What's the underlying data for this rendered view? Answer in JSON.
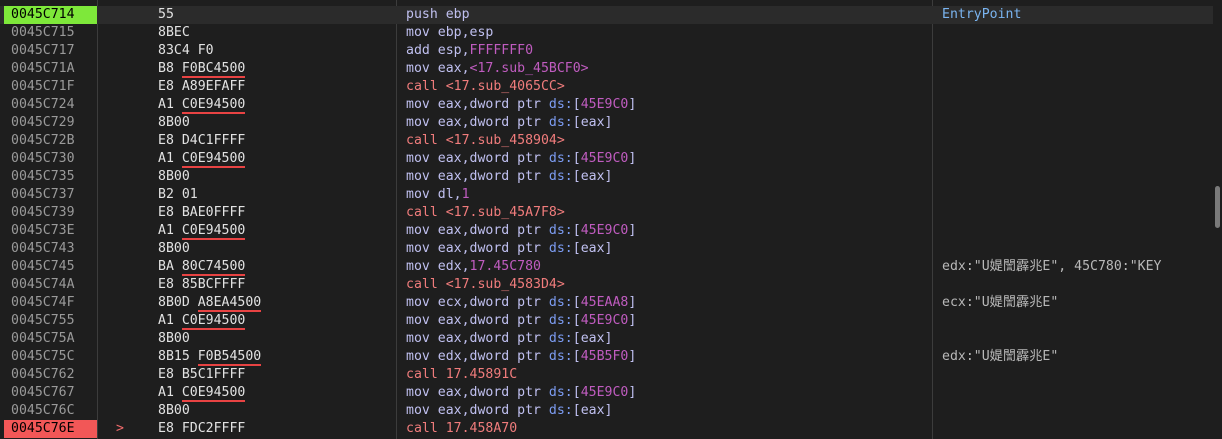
{
  "rows": [
    {
      "addr": "0045C714",
      "state": "eip",
      "mark": "",
      "b1": "55",
      "b2": "",
      "inst": [
        {
          "t": "push ebp",
          "k": "p"
        }
      ],
      "call": false,
      "comment": "EntryPoint",
      "ckind": "ep"
    },
    {
      "addr": "0045C715",
      "state": "",
      "mark": "",
      "b1": "8BEC",
      "b2": "",
      "inst": [
        {
          "t": "mov ebp,esp",
          "k": "p"
        }
      ],
      "call": false,
      "comment": "",
      "ckind": ""
    },
    {
      "addr": "0045C717",
      "state": "",
      "mark": "",
      "b1": "83C4 F0",
      "b2": "",
      "inst": [
        {
          "t": "add esp,",
          "k": "p"
        },
        {
          "t": "FFFFFFF0",
          "k": "n"
        }
      ],
      "call": false,
      "comment": "",
      "ckind": ""
    },
    {
      "addr": "0045C71A",
      "state": "",
      "mark": "",
      "b1": "B8 ",
      "b2": "F0BC4500",
      "inst": [
        {
          "t": "mov eax,",
          "k": "p"
        },
        {
          "t": "<17.sub_45BCF0>",
          "k": "n"
        }
      ],
      "call": false,
      "comment": "",
      "ckind": ""
    },
    {
      "addr": "0045C71F",
      "state": "",
      "mark": "",
      "b1": "E8 A89EFAFF",
      "b2": "",
      "inst": [
        {
          "t": "call <17.sub_4065CC>",
          "k": "p"
        }
      ],
      "call": true,
      "comment": "",
      "ckind": ""
    },
    {
      "addr": "0045C724",
      "state": "",
      "mark": "",
      "b1": "A1 ",
      "b2": "C0E94500",
      "inst": [
        {
          "t": "mov eax,dword ptr ",
          "k": "p"
        },
        {
          "t": "ds:",
          "k": "s"
        },
        {
          "t": "[",
          "k": "p"
        },
        {
          "t": "45E9C0",
          "k": "n"
        },
        {
          "t": "]",
          "k": "p"
        }
      ],
      "call": false,
      "comment": "",
      "ckind": ""
    },
    {
      "addr": "0045C729",
      "state": "",
      "mark": "",
      "b1": "8B00",
      "b2": "",
      "inst": [
        {
          "t": "mov eax,dword ptr ",
          "k": "p"
        },
        {
          "t": "ds:",
          "k": "s"
        },
        {
          "t": "[eax]",
          "k": "p"
        }
      ],
      "call": false,
      "comment": "",
      "ckind": ""
    },
    {
      "addr": "0045C72B",
      "state": "",
      "mark": "",
      "b1": "E8 D4C1FFFF",
      "b2": "",
      "inst": [
        {
          "t": "call <17.sub_458904>",
          "k": "p"
        }
      ],
      "call": true,
      "comment": "",
      "ckind": ""
    },
    {
      "addr": "0045C730",
      "state": "",
      "mark": "",
      "b1": "A1 ",
      "b2": "C0E94500",
      "inst": [
        {
          "t": "mov eax,dword ptr ",
          "k": "p"
        },
        {
          "t": "ds:",
          "k": "s"
        },
        {
          "t": "[",
          "k": "p"
        },
        {
          "t": "45E9C0",
          "k": "n"
        },
        {
          "t": "]",
          "k": "p"
        }
      ],
      "call": false,
      "comment": "",
      "ckind": ""
    },
    {
      "addr": "0045C735",
      "state": "",
      "mark": "",
      "b1": "8B00",
      "b2": "",
      "inst": [
        {
          "t": "mov eax,dword ptr ",
          "k": "p"
        },
        {
          "t": "ds:",
          "k": "s"
        },
        {
          "t": "[eax]",
          "k": "p"
        }
      ],
      "call": false,
      "comment": "",
      "ckind": ""
    },
    {
      "addr": "0045C737",
      "state": "",
      "mark": "",
      "b1": "B2 01",
      "b2": "",
      "inst": [
        {
          "t": "mov dl,",
          "k": "p"
        },
        {
          "t": "1",
          "k": "n"
        }
      ],
      "call": false,
      "comment": "",
      "ckind": ""
    },
    {
      "addr": "0045C739",
      "state": "",
      "mark": "",
      "b1": "E8 BAE0FFFF",
      "b2": "",
      "inst": [
        {
          "t": "call <17.sub_45A7F8>",
          "k": "p"
        }
      ],
      "call": true,
      "comment": "",
      "ckind": ""
    },
    {
      "addr": "0045C73E",
      "state": "",
      "mark": "",
      "b1": "A1 ",
      "b2": "C0E94500",
      "inst": [
        {
          "t": "mov eax,dword ptr ",
          "k": "p"
        },
        {
          "t": "ds:",
          "k": "s"
        },
        {
          "t": "[",
          "k": "p"
        },
        {
          "t": "45E9C0",
          "k": "n"
        },
        {
          "t": "]",
          "k": "p"
        }
      ],
      "call": false,
      "comment": "",
      "ckind": ""
    },
    {
      "addr": "0045C743",
      "state": "",
      "mark": "",
      "b1": "8B00",
      "b2": "",
      "inst": [
        {
          "t": "mov eax,dword ptr ",
          "k": "p"
        },
        {
          "t": "ds:",
          "k": "s"
        },
        {
          "t": "[eax]",
          "k": "p"
        }
      ],
      "call": false,
      "comment": "",
      "ckind": ""
    },
    {
      "addr": "0045C745",
      "state": "",
      "mark": "",
      "b1": "BA ",
      "b2": "80C74500",
      "inst": [
        {
          "t": "mov edx,",
          "k": "p"
        },
        {
          "t": "17.45C780",
          "k": "n"
        }
      ],
      "call": false,
      "comment": "edx:\"U媞誾霹兆E\", 45C780:\"KEY",
      "ckind": "c"
    },
    {
      "addr": "0045C74A",
      "state": "",
      "mark": "",
      "b1": "E8 85BCFFFF",
      "b2": "",
      "inst": [
        {
          "t": "call <17.sub_4583D4>",
          "k": "p"
        }
      ],
      "call": true,
      "comment": "",
      "ckind": ""
    },
    {
      "addr": "0045C74F",
      "state": "",
      "mark": "",
      "b1": "8B0D ",
      "b2": "A8EA4500",
      "inst": [
        {
          "t": "mov ecx,dword ptr ",
          "k": "p"
        },
        {
          "t": "ds:",
          "k": "s"
        },
        {
          "t": "[",
          "k": "p"
        },
        {
          "t": "45EAA8",
          "k": "n"
        },
        {
          "t": "]",
          "k": "p"
        }
      ],
      "call": false,
      "comment": "ecx:\"U媞誾霹兆E\"",
      "ckind": "c"
    },
    {
      "addr": "0045C755",
      "state": "",
      "mark": "",
      "b1": "A1 ",
      "b2": "C0E94500",
      "inst": [
        {
          "t": "mov eax,dword ptr ",
          "k": "p"
        },
        {
          "t": "ds:",
          "k": "s"
        },
        {
          "t": "[",
          "k": "p"
        },
        {
          "t": "45E9C0",
          "k": "n"
        },
        {
          "t": "]",
          "k": "p"
        }
      ],
      "call": false,
      "comment": "",
      "ckind": ""
    },
    {
      "addr": "0045C75A",
      "state": "",
      "mark": "",
      "b1": "8B00",
      "b2": "",
      "inst": [
        {
          "t": "mov eax,dword ptr ",
          "k": "p"
        },
        {
          "t": "ds:",
          "k": "s"
        },
        {
          "t": "[eax]",
          "k": "p"
        }
      ],
      "call": false,
      "comment": "",
      "ckind": ""
    },
    {
      "addr": "0045C75C",
      "state": "",
      "mark": "",
      "b1": "8B15 ",
      "b2": "F0B54500",
      "inst": [
        {
          "t": "mov edx,dword ptr ",
          "k": "p"
        },
        {
          "t": "ds:",
          "k": "s"
        },
        {
          "t": "[",
          "k": "p"
        },
        {
          "t": "45B5F0",
          "k": "n"
        },
        {
          "t": "]",
          "k": "p"
        }
      ],
      "call": false,
      "comment": "edx:\"U媞誾霹兆E\"",
      "ckind": "c"
    },
    {
      "addr": "0045C762",
      "state": "",
      "mark": "",
      "b1": "E8 B5C1FFFF",
      "b2": "",
      "inst": [
        {
          "t": "call 17.45891C",
          "k": "p"
        }
      ],
      "call": true,
      "comment": "",
      "ckind": ""
    },
    {
      "addr": "0045C767",
      "state": "",
      "mark": "",
      "b1": "A1 ",
      "b2": "C0E94500",
      "inst": [
        {
          "t": "mov eax,dword ptr ",
          "k": "p"
        },
        {
          "t": "ds:",
          "k": "s"
        },
        {
          "t": "[",
          "k": "p"
        },
        {
          "t": "45E9C0",
          "k": "n"
        },
        {
          "t": "]",
          "k": "p"
        }
      ],
      "call": false,
      "comment": "",
      "ckind": ""
    },
    {
      "addr": "0045C76C",
      "state": "",
      "mark": "",
      "b1": "8B00",
      "b2": "",
      "inst": [
        {
          "t": "mov eax,dword ptr ",
          "k": "p"
        },
        {
          "t": "ds:",
          "k": "s"
        },
        {
          "t": "[eax]",
          "k": "p"
        }
      ],
      "call": false,
      "comment": "",
      "ckind": ""
    },
    {
      "addr": "0045C76E",
      "state": "bp",
      "mark": ">",
      "b1": "E8 FDC2FFFF",
      "b2": "",
      "inst": [
        {
          "t": "call 17.458A70",
          "k": "p"
        }
      ],
      "call": true,
      "comment": "",
      "ckind": ""
    }
  ]
}
